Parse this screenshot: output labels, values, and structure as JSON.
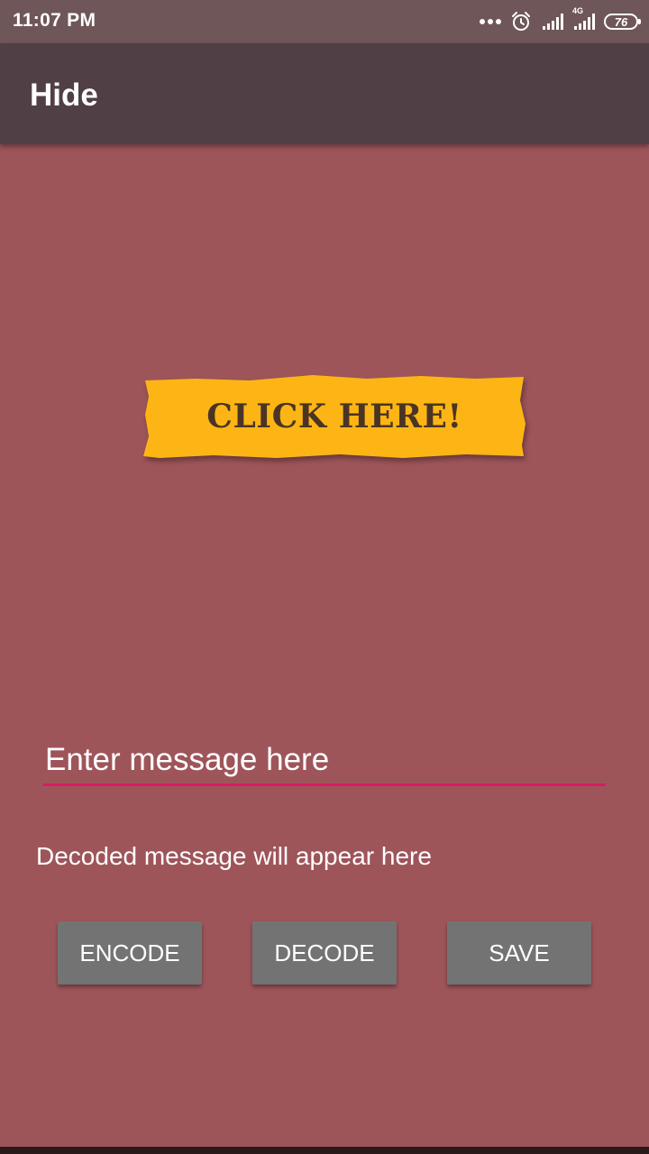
{
  "status_bar": {
    "time": "11:07 PM",
    "network_type": "4G",
    "battery_level": "76",
    "icons": [
      "more-dots-icon",
      "alarm-icon",
      "signal-icon",
      "signal-4g-icon",
      "battery-icon"
    ]
  },
  "app_bar": {
    "title": "Hide"
  },
  "banner": {
    "label": "CLICK HERE!",
    "color": "#fdb515",
    "text_color": "#4a3424"
  },
  "message_input": {
    "placeholder": "Enter message here",
    "value": "",
    "underline_color": "#d81b60"
  },
  "decoded_message": {
    "text": "Decoded message will appear here"
  },
  "buttons": {
    "encode_label": "ENCODE",
    "decode_label": "DECODE",
    "save_label": "SAVE"
  },
  "colors": {
    "background": "#9e555a",
    "app_bar": "#513f46",
    "status_bar": "#6f5659",
    "button": "#737373"
  }
}
